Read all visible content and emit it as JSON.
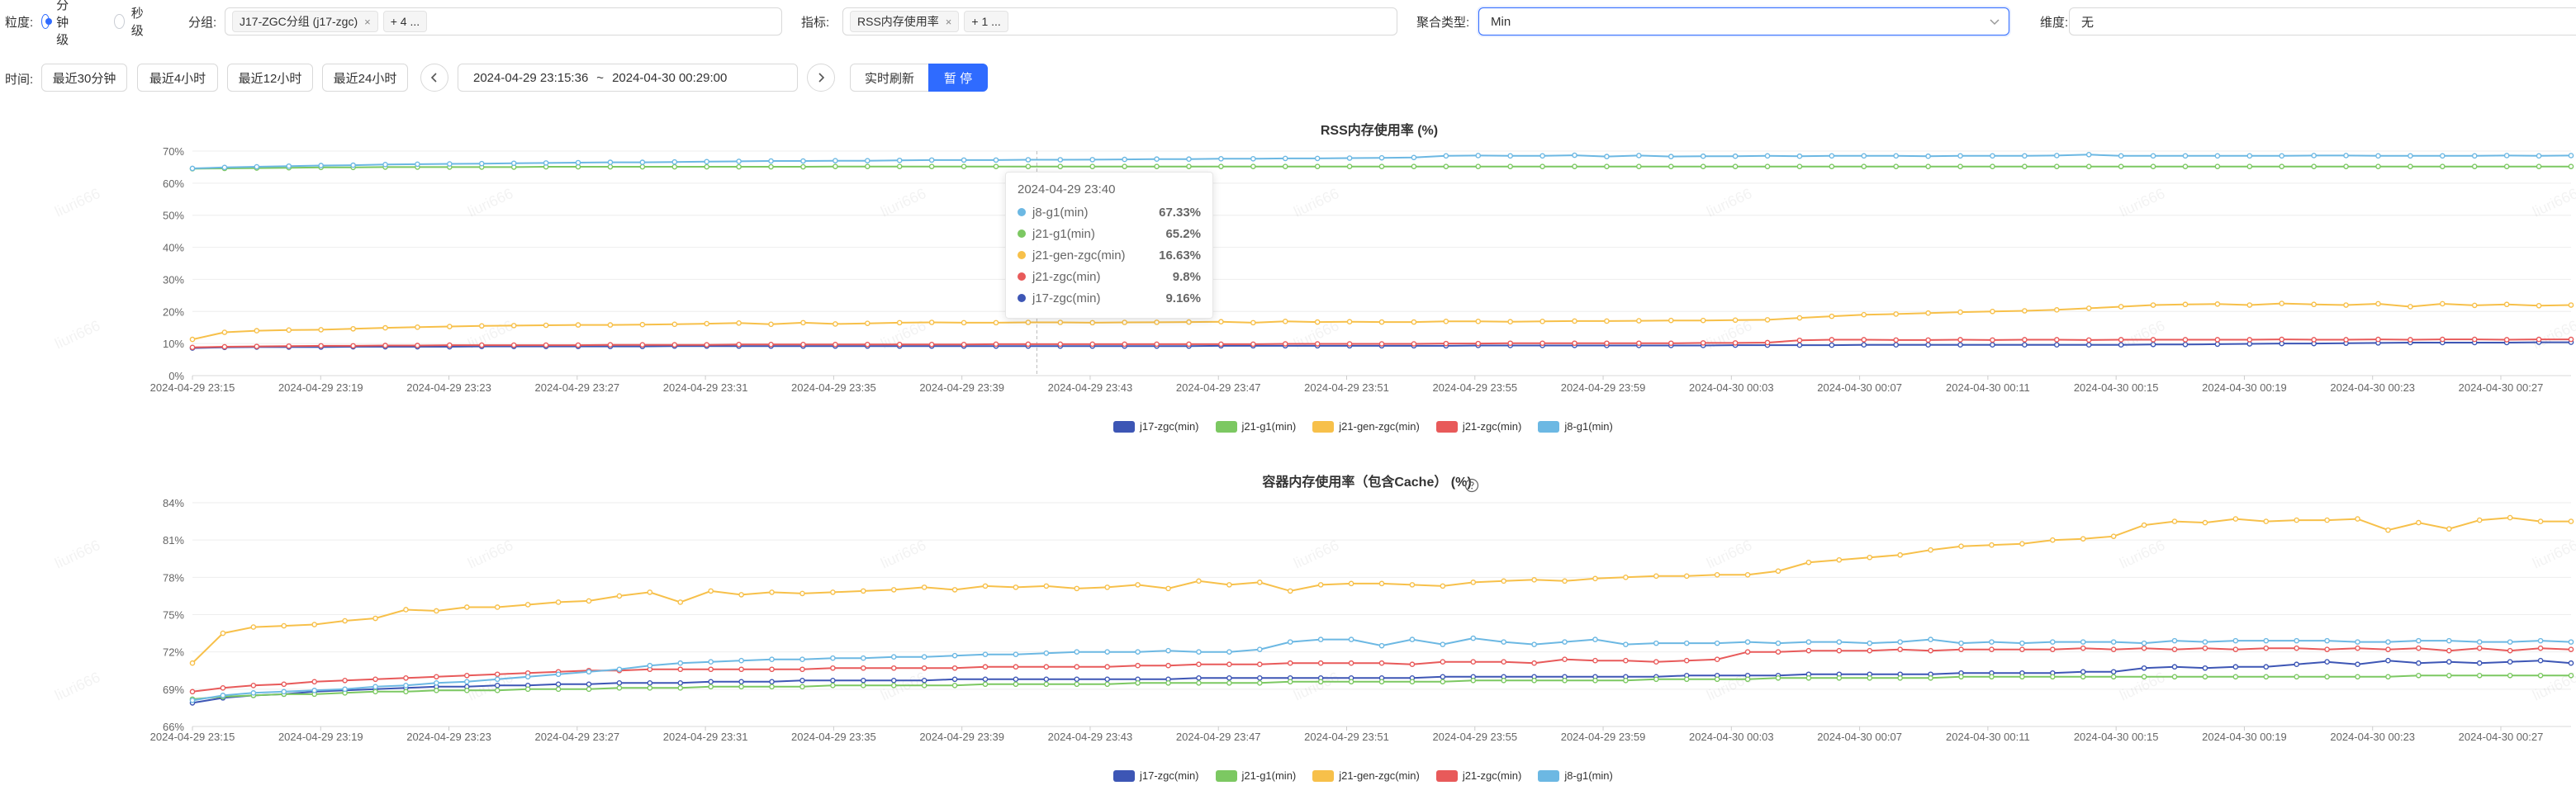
{
  "filters": {
    "granularity_label": "粒度:",
    "granularity_options": [
      "分钟级",
      "秒级"
    ],
    "group_label": "分组:",
    "group_tag": "J17-ZGC分组 (j17-zgc)",
    "group_more": "+ 4 ...",
    "metric_label": "指标:",
    "metric_tag": "RSS内存使用率",
    "metric_more": "+ 1 ...",
    "agg_label": "聚合类型:",
    "agg_value": "Min",
    "dim_label": "维度:",
    "dim_value": "无"
  },
  "time": {
    "label": "时间:",
    "quick": [
      "最近30分钟",
      "最近4小时",
      "最近12小时",
      "最近24小时"
    ],
    "range_start": "2024-04-29 23:15:36",
    "range_sep": "~",
    "range_end": "2024-04-30 00:29:00",
    "realtime": "实时刷新",
    "pause": "暂 停"
  },
  "colors": {
    "j17": "#3d56b5",
    "j21g1": "#7cc862",
    "j21gen": "#f7c04a",
    "j21zgc": "#e85a5a",
    "j8": "#6cb8e3",
    "accent": "#2f6bff"
  },
  "watermark": "liuri666",
  "x_ticks": [
    "2024-04-29 23:15",
    "2024-04-29 23:19",
    "2024-04-29 23:23",
    "2024-04-29 23:27",
    "2024-04-29 23:31",
    "2024-04-29 23:35",
    "2024-04-29 23:39",
    "2024-04-29 23:43",
    "2024-04-29 23:47",
    "2024-04-29 23:51",
    "2024-04-29 23:55",
    "2024-04-29 23:59",
    "2024-04-30 00:03",
    "2024-04-30 00:07",
    "2024-04-30 00:11",
    "2024-04-30 00:15",
    "2024-04-30 00:19",
    "2024-04-30 00:23",
    "2024-04-30 00:27"
  ],
  "chart_data": [
    {
      "type": "line",
      "title": "RSS内存使用率 (%)",
      "y_ticks": [
        "0%",
        "10%",
        "20%",
        "30%",
        "40%",
        "50%",
        "60%",
        "70%"
      ],
      "ylim": [
        0,
        70
      ],
      "legend": "bottom-center",
      "series": [
        {
          "name": "j17-zgc(min)",
          "color_key": "j17",
          "values": [
            8.6,
            8.8,
            8.9,
            8.9,
            8.9,
            9.0,
            9.0,
            9.0,
            9.0,
            9.1,
            9.1,
            9.1,
            9.1,
            9.1,
            9.1,
            9.2,
            9.2,
            9.2,
            9.2,
            9.2,
            9.2,
            9.2,
            9.2,
            9.2,
            9.2,
            9.2,
            9.2,
            9.2,
            9.2,
            9.2,
            9.2,
            9.2,
            9.3,
            9.3,
            9.3,
            9.3,
            9.3,
            9.3,
            9.3,
            9.3,
            9.4,
            9.4,
            9.4,
            9.4,
            9.4,
            9.4,
            9.4,
            9.4,
            9.5,
            9.5,
            9.5,
            9.5,
            9.6,
            9.6,
            9.6,
            9.6,
            9.6,
            9.6,
            9.6,
            9.6,
            9.6,
            9.7,
            9.7,
            9.8,
            9.9,
            10.0,
            10.0,
            10.1,
            10.2,
            10.3,
            10.3,
            10.3,
            10.3,
            10.4,
            10.4
          ]
        },
        {
          "name": "j21-g1(min)",
          "color_key": "j21g1",
          "values": [
            64.5,
            64.6,
            64.7,
            64.8,
            64.9,
            64.9,
            65.0,
            65.0,
            65.0,
            65.0,
            65.0,
            65.1,
            65.1,
            65.1,
            65.1,
            65.1,
            65.1,
            65.1,
            65.1,
            65.1,
            65.2,
            65.2,
            65.2,
            65.2,
            65.2,
            65.2,
            65.2,
            65.2,
            65.2,
            65.2,
            65.2,
            65.2,
            65.2,
            65.2,
            65.2,
            65.2,
            65.2,
            65.2,
            65.2,
            65.2,
            65.2,
            65.2,
            65.2,
            65.2,
            65.2,
            65.2,
            65.2,
            65.2,
            65.2,
            65.2,
            65.2,
            65.2,
            65.2,
            65.2,
            65.2,
            65.2,
            65.2,
            65.2,
            65.2,
            65.2,
            65.2,
            65.2,
            65.2,
            65.2,
            65.2,
            65.2,
            65.2,
            65.2,
            65.2,
            65.2,
            65.2,
            65.2,
            65.2,
            65.2,
            65.2
          ]
        },
        {
          "name": "j21-gen-zgc(min)",
          "color_key": "j21gen",
          "values": [
            11.3,
            13.5,
            14.0,
            14.2,
            14.3,
            14.6,
            14.9,
            15.1,
            15.3,
            15.5,
            15.6,
            15.7,
            15.8,
            15.8,
            15.9,
            16.0,
            16.2,
            16.4,
            16.0,
            16.5,
            16.1,
            16.3,
            16.5,
            16.6,
            16.5,
            16.5,
            16.6,
            16.6,
            16.5,
            16.6,
            16.63,
            16.7,
            16.8,
            16.5,
            16.9,
            16.7,
            16.8,
            16.7,
            16.7,
            16.9,
            16.9,
            16.8,
            16.9,
            17.0,
            17.0,
            17.1,
            17.2,
            17.2,
            17.3,
            17.4,
            18.0,
            18.5,
            19.0,
            19.2,
            19.5,
            19.8,
            20.0,
            20.2,
            20.5,
            21.0,
            21.5,
            22.0,
            22.2,
            22.3,
            22.0,
            22.5,
            22.2,
            22.0,
            22.4,
            21.5,
            22.4,
            21.9,
            22.2,
            21.8,
            22.0
          ]
        },
        {
          "name": "j21-zgc(min)",
          "color_key": "j21zgc",
          "values": [
            8.8,
            9.0,
            9.1,
            9.2,
            9.3,
            9.3,
            9.4,
            9.4,
            9.5,
            9.5,
            9.5,
            9.5,
            9.5,
            9.6,
            9.6,
            9.6,
            9.6,
            9.7,
            9.7,
            9.7,
            9.7,
            9.7,
            9.7,
            9.7,
            9.7,
            9.8,
            9.8,
            9.8,
            9.8,
            9.8,
            9.8,
            9.8,
            9.8,
            9.8,
            9.9,
            9.9,
            9.9,
            9.9,
            9.9,
            10.0,
            10.0,
            10.1,
            10.1,
            10.1,
            10.1,
            10.1,
            10.1,
            10.2,
            10.2,
            10.3,
            11.0,
            11.2,
            11.2,
            11.1,
            11.1,
            11.2,
            11.1,
            11.2,
            11.2,
            11.1,
            11.2,
            11.2,
            11.2,
            11.2,
            11.2,
            11.3,
            11.2,
            11.2,
            11.3,
            11.2,
            11.3,
            11.3,
            11.2,
            11.3,
            11.3
          ]
        },
        {
          "name": "j8-g1(min)",
          "color_key": "j8",
          "values": [
            64.6,
            64.9,
            65.1,
            65.3,
            65.5,
            65.6,
            65.8,
            65.9,
            66.0,
            66.1,
            66.2,
            66.3,
            66.4,
            66.5,
            66.5,
            66.6,
            66.7,
            66.8,
            66.9,
            66.9,
            67.0,
            67.0,
            67.1,
            67.2,
            67.2,
            67.2,
            67.3,
            67.3,
            67.33,
            67.4,
            67.5,
            67.5,
            67.6,
            67.6,
            67.7,
            67.7,
            67.8,
            67.9,
            68.0,
            68.5,
            68.6,
            68.5,
            68.5,
            68.7,
            68.3,
            68.6,
            68.3,
            68.4,
            68.4,
            68.5,
            68.4,
            68.5,
            68.5,
            68.5,
            68.4,
            68.5,
            68.5,
            68.5,
            68.6,
            68.9,
            68.5,
            68.5,
            68.5,
            68.5,
            68.5,
            68.5,
            68.6,
            68.6,
            68.5,
            68.5,
            68.5,
            68.5,
            68.6,
            68.5,
            68.6
          ]
        }
      ],
      "tooltip": {
        "title": "2024-04-29 23:40",
        "rows": [
          {
            "name": "j8-g1(min)",
            "value": "67.33%",
            "color_key": "j8"
          },
          {
            "name": "j21-g1(min)",
            "value": "65.2%",
            "color_key": "j21g1"
          },
          {
            "name": "j21-gen-zgc(min)",
            "value": "16.63%",
            "color_key": "j21gen"
          },
          {
            "name": "j21-zgc(min)",
            "value": "9.8%",
            "color_key": "j21zgc"
          },
          {
            "name": "j17-zgc(min)",
            "value": "9.16%",
            "color_key": "j17"
          }
        ]
      }
    },
    {
      "type": "line",
      "title": "容器内存使用率（包含Cache） (%)",
      "y_ticks": [
        "66%",
        "69%",
        "72%",
        "75%",
        "78%",
        "81%",
        "84%"
      ],
      "ylim": [
        66,
        84
      ],
      "legend": "bottom-center",
      "series": [
        {
          "name": "j17-zgc(min)",
          "color_key": "j17",
          "values": [
            67.9,
            68.3,
            68.5,
            68.6,
            68.8,
            68.9,
            69.0,
            69.1,
            69.2,
            69.2,
            69.3,
            69.3,
            69.4,
            69.4,
            69.5,
            69.5,
            69.5,
            69.6,
            69.6,
            69.6,
            69.7,
            69.7,
            69.7,
            69.7,
            69.7,
            69.8,
            69.8,
            69.8,
            69.8,
            69.8,
            69.8,
            69.8,
            69.8,
            69.9,
            69.9,
            69.9,
            69.9,
            69.9,
            69.9,
            69.9,
            69.9,
            70.0,
            70.0,
            70.0,
            70.0,
            70.0,
            70.0,
            70.0,
            70.0,
            70.1,
            70.1,
            70.1,
            70.1,
            70.2,
            70.2,
            70.2,
            70.2,
            70.2,
            70.3,
            70.3,
            70.3,
            70.3,
            70.4,
            70.4,
            70.7,
            70.8,
            70.7,
            70.8,
            70.8,
            71.0,
            71.2,
            71.0,
            71.3,
            71.1,
            71.2,
            71.1,
            71.2,
            71.3,
            71.1
          ]
        },
        {
          "name": "j21-g1(min)",
          "color_key": "j21g1",
          "values": [
            68.2,
            68.4,
            68.5,
            68.6,
            68.6,
            68.7,
            68.8,
            68.8,
            68.9,
            68.9,
            68.9,
            69.0,
            69.0,
            69.0,
            69.1,
            69.1,
            69.1,
            69.2,
            69.2,
            69.2,
            69.2,
            69.3,
            69.3,
            69.3,
            69.3,
            69.3,
            69.4,
            69.4,
            69.4,
            69.4,
            69.4,
            69.5,
            69.5,
            69.5,
            69.5,
            69.5,
            69.6,
            69.6,
            69.6,
            69.6,
            69.6,
            69.6,
            69.7,
            69.7,
            69.7,
            69.7,
            69.7,
            69.7,
            69.8,
            69.8,
            69.8,
            69.8,
            69.9,
            69.9,
            69.9,
            69.9,
            69.9,
            69.9,
            70.0,
            70.0,
            70.0,
            70.0,
            70.0,
            70.0,
            70.0,
            70.0,
            70.0,
            70.0,
            70.0,
            70.0,
            70.0,
            70.0,
            70.0,
            70.1,
            70.1,
            70.1,
            70.1,
            70.1,
            70.1
          ]
        },
        {
          "name": "j21-gen-zgc(min)",
          "color_key": "j21gen",
          "values": [
            71.1,
            73.5,
            74.0,
            74.1,
            74.2,
            74.5,
            74.7,
            75.4,
            75.3,
            75.6,
            75.6,
            75.8,
            76.0,
            76.1,
            76.5,
            76.8,
            76.0,
            76.9,
            76.6,
            76.8,
            76.7,
            76.8,
            76.9,
            77.0,
            77.2,
            77.0,
            77.3,
            77.2,
            77.3,
            77.1,
            77.2,
            77.4,
            77.1,
            77.7,
            77.4,
            77.6,
            76.9,
            77.4,
            77.5,
            77.5,
            77.4,
            77.3,
            77.6,
            77.7,
            77.8,
            77.7,
            77.9,
            78.0,
            78.1,
            78.1,
            78.2,
            78.2,
            78.5,
            79.2,
            79.4,
            79.6,
            79.8,
            80.2,
            80.5,
            80.6,
            80.7,
            81.0,
            81.1,
            81.3,
            82.2,
            82.5,
            82.4,
            82.7,
            82.5,
            82.6,
            82.6,
            82.7,
            81.8,
            82.4,
            81.9,
            82.6,
            82.8,
            82.5,
            82.5
          ]
        },
        {
          "name": "j21-zgc(min)",
          "color_key": "j21zgc",
          "values": [
            68.8,
            69.1,
            69.3,
            69.4,
            69.6,
            69.7,
            69.8,
            69.9,
            70.0,
            70.1,
            70.2,
            70.3,
            70.4,
            70.5,
            70.5,
            70.6,
            70.6,
            70.6,
            70.6,
            70.6,
            70.6,
            70.7,
            70.7,
            70.7,
            70.7,
            70.7,
            70.8,
            70.8,
            70.8,
            70.8,
            70.8,
            70.9,
            70.9,
            71.0,
            71.0,
            71.0,
            71.1,
            71.1,
            71.1,
            71.1,
            71.0,
            71.2,
            71.2,
            71.2,
            71.1,
            71.4,
            71.3,
            71.3,
            71.2,
            71.3,
            71.4,
            72.0,
            72.0,
            72.1,
            72.1,
            72.1,
            72.2,
            72.1,
            72.2,
            72.2,
            72.2,
            72.2,
            72.3,
            72.2,
            72.3,
            72.2,
            72.3,
            72.2,
            72.3,
            72.3,
            72.2,
            72.3,
            72.2,
            72.3,
            72.1,
            72.3,
            72.1,
            72.3,
            72.2
          ]
        },
        {
          "name": "j8-g1(min)",
          "color_key": "j8",
          "values": [
            68.1,
            68.5,
            68.7,
            68.8,
            68.9,
            69.0,
            69.2,
            69.3,
            69.5,
            69.6,
            69.8,
            70.0,
            70.2,
            70.4,
            70.6,
            70.9,
            71.1,
            71.2,
            71.3,
            71.4,
            71.4,
            71.5,
            71.5,
            71.6,
            71.6,
            71.7,
            71.8,
            71.8,
            71.9,
            72.0,
            72.0,
            72.0,
            72.1,
            72.0,
            72.0,
            72.2,
            72.8,
            73.0,
            73.0,
            72.5,
            73.0,
            72.6,
            73.1,
            72.8,
            72.6,
            72.8,
            73.0,
            72.6,
            72.7,
            72.7,
            72.7,
            72.8,
            72.7,
            72.8,
            72.8,
            72.7,
            72.8,
            73.0,
            72.7,
            72.8,
            72.7,
            72.8,
            72.8,
            72.8,
            72.7,
            72.9,
            72.8,
            72.9,
            72.9,
            72.9,
            72.9,
            72.8,
            72.8,
            72.9,
            72.9,
            72.8,
            72.8,
            72.9,
            72.8
          ]
        }
      ]
    }
  ]
}
